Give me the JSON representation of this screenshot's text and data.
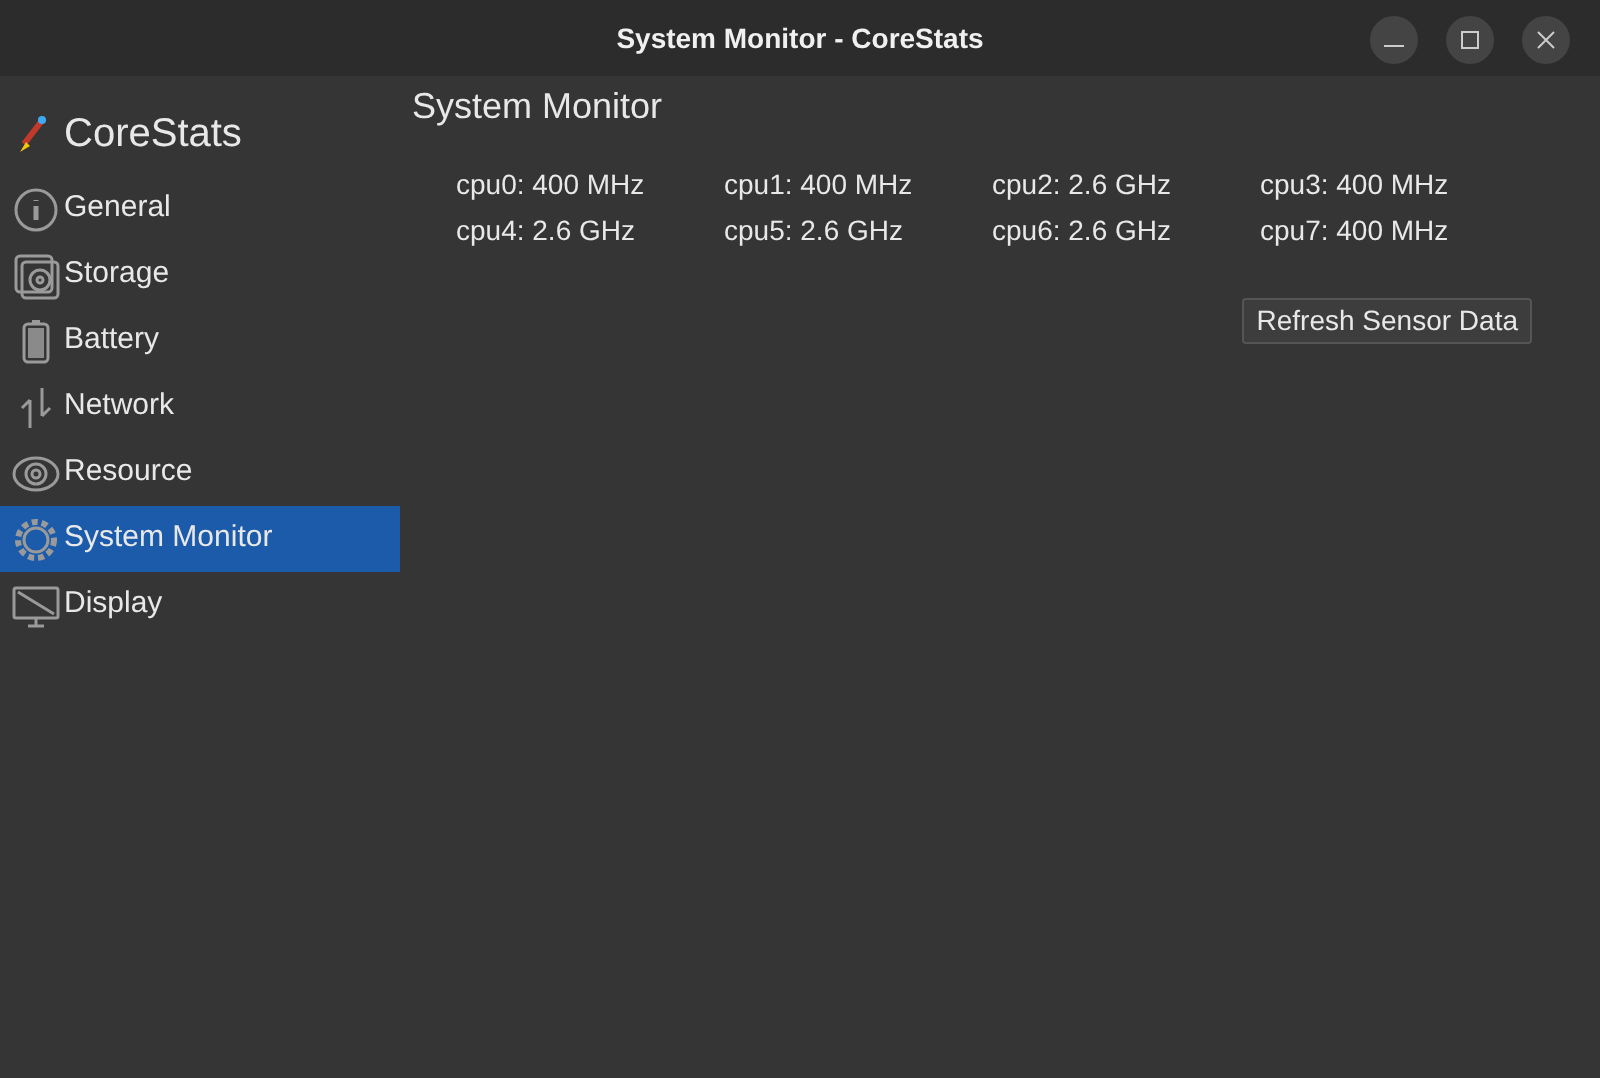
{
  "window": {
    "title": "System Monitor - CoreStats"
  },
  "app": {
    "name": "CoreStats"
  },
  "sidebar": {
    "items": [
      {
        "label": "General",
        "selected": false
      },
      {
        "label": "Storage",
        "selected": false
      },
      {
        "label": "Battery",
        "selected": false
      },
      {
        "label": "Network",
        "selected": false
      },
      {
        "label": "Resource",
        "selected": false
      },
      {
        "label": "System Monitor",
        "selected": true
      },
      {
        "label": "Display",
        "selected": false
      }
    ]
  },
  "page": {
    "title": "System Monitor",
    "cpus": [
      "cpu0: 400 MHz",
      "cpu1: 400 MHz",
      "cpu2: 2.6 GHz",
      "cpu3: 400 MHz",
      "cpu4: 2.6 GHz",
      "cpu5: 2.6 GHz",
      "cpu6: 2.6 GHz",
      "cpu7: 400 MHz"
    ],
    "button": "Refresh Sensor Data"
  }
}
